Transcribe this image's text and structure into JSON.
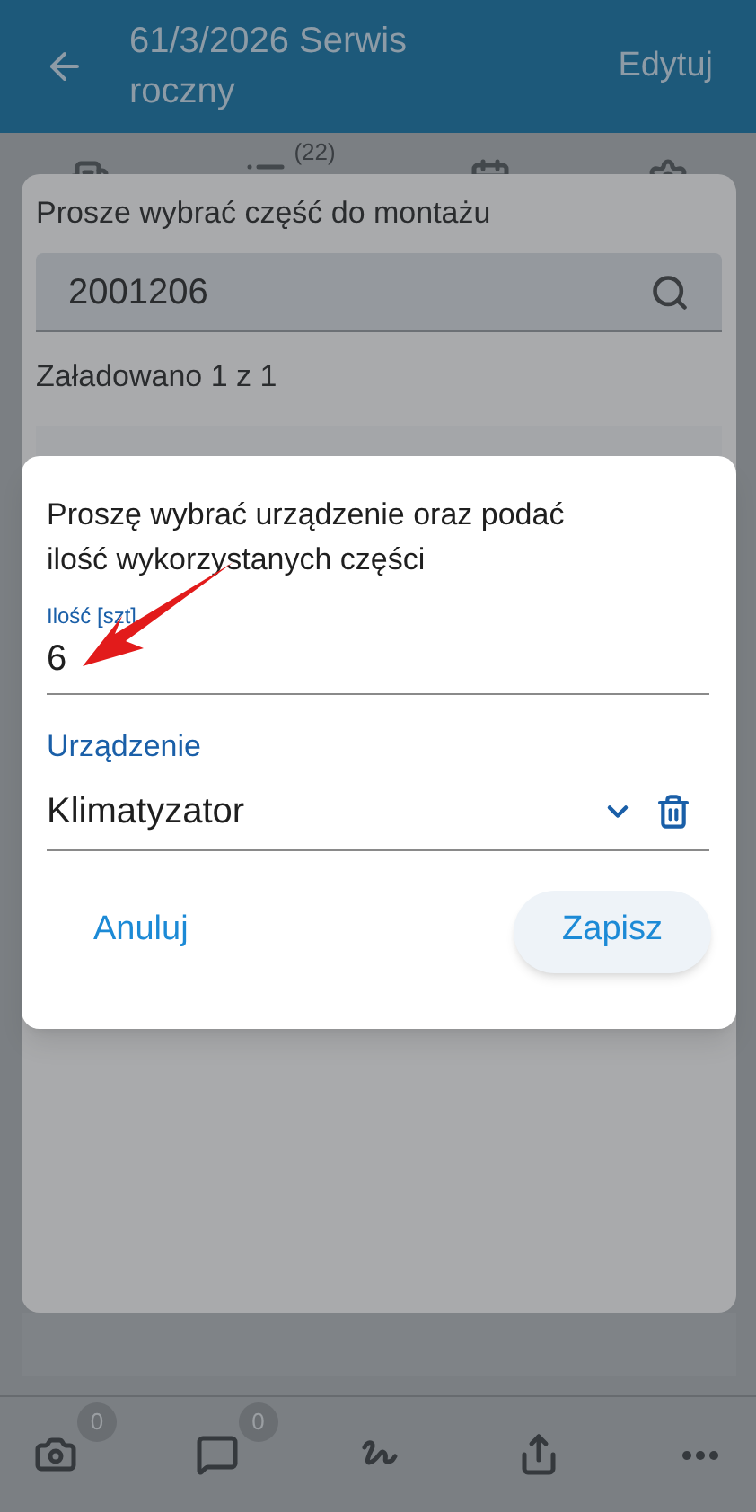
{
  "header": {
    "title": "61/3/2026 Serwis roczny",
    "action": "Edytuj"
  },
  "tabs": [
    {
      "kind": "building"
    },
    {
      "kind": "list",
      "badge": "(22)"
    },
    {
      "kind": "calendar"
    },
    {
      "kind": "gear"
    }
  ],
  "part_dialog": {
    "title": "Prosze wybrać część do montażu",
    "search_value": "2001206",
    "loaded": "Załadowano 1 z 1"
  },
  "device_dialog": {
    "message": "Proszę wybrać urządzenie oraz podać ilość wykorzystanych części",
    "quantity_label": "Ilość [szt]",
    "quantity_value": "6",
    "device_label": "Urządzenie",
    "device_value": "Klimatyzator",
    "cancel": "Anuluj",
    "save": "Zapisz"
  },
  "toolbar": [
    {
      "kind": "camera",
      "badge": "0"
    },
    {
      "kind": "note",
      "badge": "0"
    },
    {
      "kind": "signature"
    },
    {
      "kind": "share"
    },
    {
      "kind": "more"
    }
  ]
}
